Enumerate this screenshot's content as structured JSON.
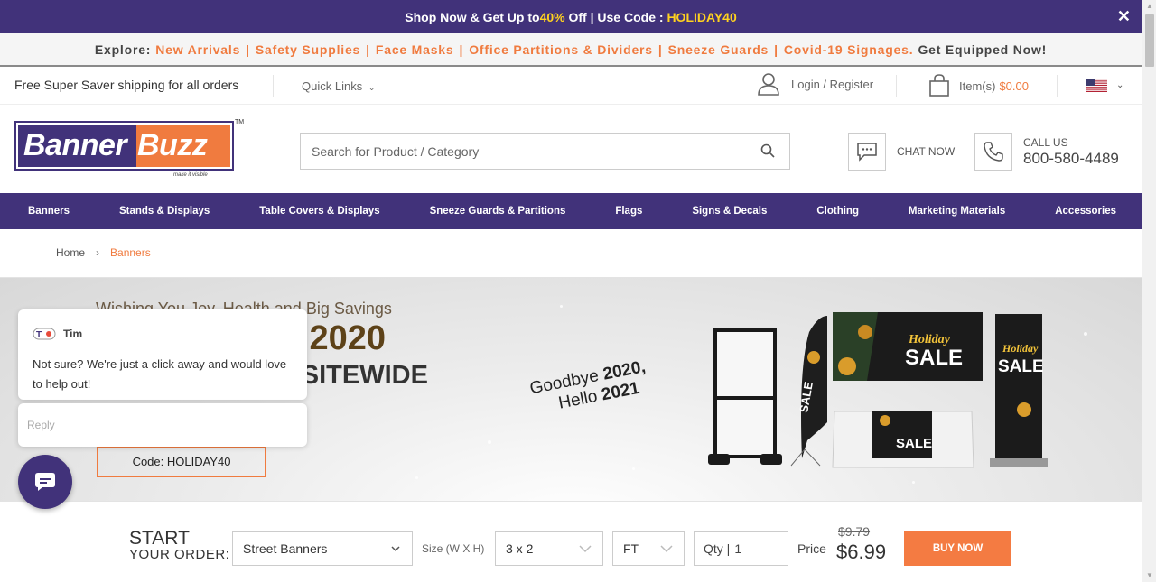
{
  "promo": {
    "prefix": "Shop Now & Get Up to ",
    "percent": "40%",
    "middle": " Off | Use Code : ",
    "code": "HOLIDAY40"
  },
  "explore": {
    "label": "Explore:",
    "links": [
      "New Arrivals",
      "Safety Supplies",
      "Face Masks",
      "Office Partitions & Dividers",
      "Sneeze Guards",
      "Covid-19 Signages"
    ],
    "tail": "Get Equipped Now!"
  },
  "utility": {
    "shipping": "Free Super Saver shipping for all orders",
    "quick_links": "Quick Links",
    "login": "Login / Register",
    "cart_label": "Item(s)",
    "cart_amount": "$0.00"
  },
  "header": {
    "logo_left": "Banner",
    "logo_right": "Buzz",
    "logo_tm": "TM",
    "logo_tag": "make it visible",
    "search_placeholder": "Search for Product / Category",
    "chat_label": "CHAT NOW",
    "call_label": "CALL US",
    "phone": "800-580-4489"
  },
  "nav": [
    "Banners",
    "Stands & Displays",
    "Table Covers & Displays",
    "Sneeze Guards & Partitions",
    "Flags",
    "Signs & Decals",
    "Clothing",
    "Marketing Materials",
    "Accessories"
  ],
  "breadcrumb": {
    "home": "Home",
    "current": "Banners"
  },
  "hero": {
    "wish": "Wishing You Joy, Health and Big Savings",
    "sale": "Holiday Sale 2020",
    "offer": "UP TO 40% OFF SITEWIDE",
    "code": "Code: HOLIDAY40",
    "goodbye": "Goodbye",
    "y2020": "2020,",
    "hello": "Hello",
    "y2021": "2021",
    "banner_sale_top": "Holiday",
    "banner_sale_bottom": "SALE",
    "flag_sale": "SALE"
  },
  "chat_widget": {
    "agent": "Tim",
    "message": "Not sure? We're just a click away and would love to help out!",
    "reply_placeholder": "Reply"
  },
  "order": {
    "start": "START",
    "start_sub": "YOUR ORDER:",
    "product": "Street Banners",
    "size_label": "Size (W X H)",
    "size": "3 x 2",
    "unit": "FT",
    "qty_label": "Qty |",
    "qty": "1",
    "price_label": "Price",
    "old_price": "$9.79",
    "new_price": "$6.99",
    "buy": "BUY NOW"
  },
  "colors": {
    "brand_purple": "#41327a",
    "accent_orange": "#f07b3f",
    "promo_yellow": "#ffd21f"
  }
}
